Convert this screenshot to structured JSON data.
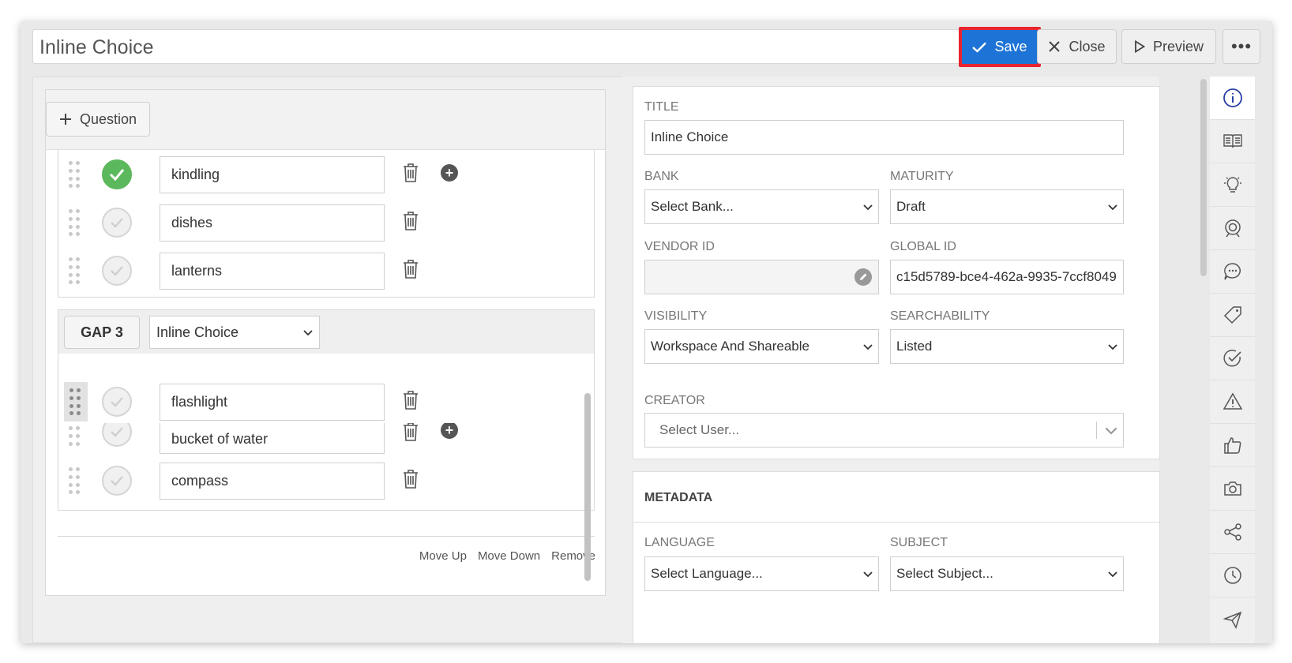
{
  "header": {
    "title_value": "Inline Choice",
    "save_label": "Save",
    "close_label": "Close",
    "preview_label": "Preview",
    "more_label": "•••"
  },
  "left": {
    "add_question_label": "Question",
    "gap2_choices": [
      {
        "text": "kindling",
        "correct": true
      },
      {
        "text": "dishes",
        "correct": false
      },
      {
        "text": "lanterns",
        "correct": false
      }
    ],
    "gap3": {
      "label": "GAP 3",
      "type_selected": "Inline Choice",
      "choices": [
        {
          "text": "flashlight",
          "correct": false
        },
        {
          "text": "bucket of water",
          "correct": false
        },
        {
          "text": "compass",
          "correct": false
        }
      ]
    },
    "footer": {
      "move_up": "Move Up",
      "move_down": "Move Down",
      "remove": "Remove"
    }
  },
  "info": {
    "title_label": "TITLE",
    "title_value": "Inline Choice",
    "bank_label": "BANK",
    "bank_value": "Select Bank...",
    "maturity_label": "MATURITY",
    "maturity_value": "Draft",
    "vendor_id_label": "VENDOR ID",
    "vendor_id_value": "",
    "global_id_label": "GLOBAL ID",
    "global_id_value": "c15d5789-bce4-462a-9935-7ccf8049",
    "visibility_label": "VISIBILITY",
    "visibility_value": "Workspace And Shareable",
    "searchability_label": "SEARCHABILITY",
    "searchability_value": "Listed",
    "creator_label": "CREATOR",
    "creator_placeholder": "Select User..."
  },
  "metadata": {
    "heading": "METADATA",
    "language_label": "LANGUAGE",
    "language_value": "Select Language...",
    "subject_label": "SUBJECT",
    "subject_value": "Select Subject..."
  },
  "rail": [
    "info-icon",
    "book-icon",
    "lightbulb-icon",
    "target-icon",
    "comment-icon",
    "tag-icon",
    "check-circle-icon",
    "warning-icon",
    "thumbs-up-icon",
    "camera-icon",
    "share-icon",
    "clock-icon",
    "send-icon"
  ],
  "colors": {
    "save_blue": "#1d74d6",
    "highlight_red": "#e8242f",
    "correct_green": "#5cb85c"
  }
}
